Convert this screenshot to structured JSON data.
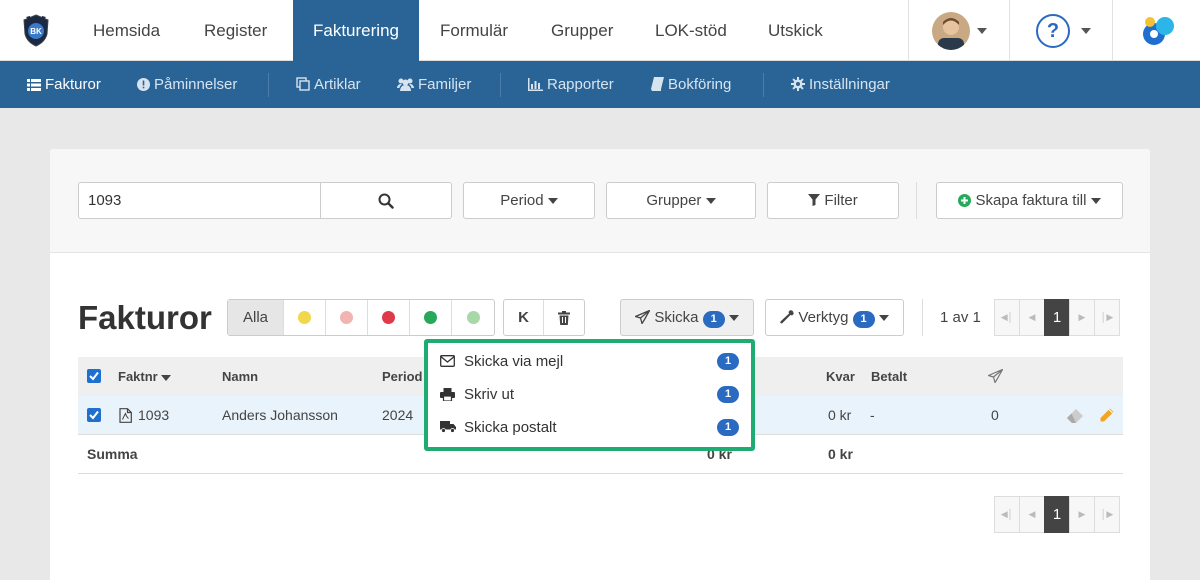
{
  "topnav": {
    "items": [
      "Hemsida",
      "Register",
      "Fakturering",
      "Formulär",
      "Grupper",
      "LOK-stöd",
      "Utskick"
    ],
    "active": "Fakturering",
    "logo_text": "BK",
    "help_icon": "?"
  },
  "subnav": {
    "items": [
      "Fakturor",
      "Påminnelser",
      "Artiklar",
      "Familjer",
      "Rapporter",
      "Bokföring",
      "Inställningar"
    ]
  },
  "toolbar": {
    "search_value": "1093",
    "period_label": "Period",
    "groups_label": "Grupper",
    "filter_label": "Filter",
    "create_label": "Skapa faktura till"
  },
  "list": {
    "title": "Fakturor",
    "all_label": "Alla",
    "k_label": "K",
    "status_colors": [
      "#f0d84a",
      "#f2b3b3",
      "#e0394a",
      "#27a85a",
      "#a8d8a8"
    ],
    "send_label": "Skicka",
    "send_count": "1",
    "tools_label": "Verktyg",
    "tools_count": "1",
    "page_info": "1 av 1",
    "current_page": "1"
  },
  "table": {
    "headers": {
      "faktnr": "Faktnr",
      "namn": "Namn",
      "period": "Period",
      "kvar": "Kvar",
      "betalt": "Betalt"
    },
    "row": {
      "faktnr": "1093",
      "namn": "Anders Johansson",
      "period": "2024",
      "kvar": "0 kr",
      "betalt": "-",
      "sent": "0"
    },
    "summary": {
      "label": "Summa",
      "total": "0 kr",
      "kvar": "0 kr"
    }
  },
  "dropdown": {
    "items": [
      {
        "label": "Skicka via mejl",
        "count": "1",
        "icon": "envelope-icon"
      },
      {
        "label": "Skriv ut",
        "count": "1",
        "icon": "print-icon"
      },
      {
        "label": "Skicka postalt",
        "count": "1",
        "icon": "truck-icon"
      }
    ],
    "highlight_color": "#1eac72"
  }
}
